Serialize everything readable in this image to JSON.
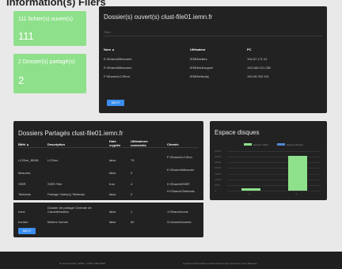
{
  "page_title": "Information(s) Fliers",
  "tiles": [
    {
      "label": "111 fichier(s) ouvert(s)",
      "value": "111"
    },
    {
      "label": "2 Dossier(s) partagé(s)",
      "value": "2"
    }
  ],
  "open_files": {
    "title": "Dossier(s) ouvert(s) clust-file01.iemn.fr",
    "filter_placeholder": "Filter",
    "columns": [
      "Nom ▲",
      "Utilisateur",
      "PC"
    ],
    "rows": [
      [
        "E:\\Shared\\Mesures\\",
        "IEMN\\adlies",
        "194.57.171.31"
      ],
      [
        "E:\\Shared\\Mesures\\",
        "IEMN\\dubrugner",
        "193.168.101.280"
      ],
      [
        "F:\\Shares\\LCISen\\",
        "IEMN\\mikolaj",
        "193.49.202.101"
      ]
    ],
    "next_label": "NEXT"
  },
  "shares": {
    "title": "Dossiers Partagés clust-file01.iemn.fr",
    "filter_placeholder": "Filter",
    "columns": [
      "Nom ▲",
      "Description",
      "Date cryptée",
      "Utilisateurs connectés",
      "Chemin"
    ],
    "rows": [
      [
        "LCISen_IEMN",
        "LCISen",
        "false",
        "79",
        "F:\\Shares\\LCISen"
      ],
      [
        "Mesures",
        "",
        "false",
        "0",
        "E:\\Shares\\Mesures"
      ],
      [
        "SISR",
        "SISR Filer",
        "true",
        "4",
        "K:\\Shared\\SISR"
      ],
      [
        "Teletests",
        "Partage Vidéo(s) Teletests",
        "false",
        "0",
        "H:\\Shares\\Teletests"
      ],
      [
        "cons",
        "Dossier de partage Centrale de Caractérisation",
        "false",
        "1",
        "J:\\Shared\\cons"
      ],
      [
        "homes",
        "fichiers homes",
        "false",
        "60",
        "G:\\shares\\homes"
      ]
    ],
    "next_label": "NEXT"
  },
  "disk": {
    "title": "Espace disques",
    "legend": [
      {
        "name": "Espace Utilisé",
        "color": "#8ee08a"
      },
      {
        "name": "Espace Restant",
        "color": "#4f86d6"
      }
    ]
  },
  "chart_data": {
    "type": "bar",
    "title": "Espace disques",
    "categories": [
      "F:",
      "E:"
    ],
    "series": [
      {
        "name": "Espace Utilisé",
        "values": [
          2000,
          31000
        ]
      },
      {
        "name": "Espace Restant",
        "values": [
          0,
          0
        ]
      }
    ],
    "ylim": [
      0,
      35000
    ],
    "yticks": [
      0,
      5000,
      10000,
      15000,
      20000,
      25000,
      30000,
      35000
    ],
    "legend_position": "top"
  },
  "footer": {
    "left": "du Smal Gautier | IEMN - CNRS UMR 8520",
    "right": "Système d'information et administration des Systèmes et des Réseaux"
  }
}
